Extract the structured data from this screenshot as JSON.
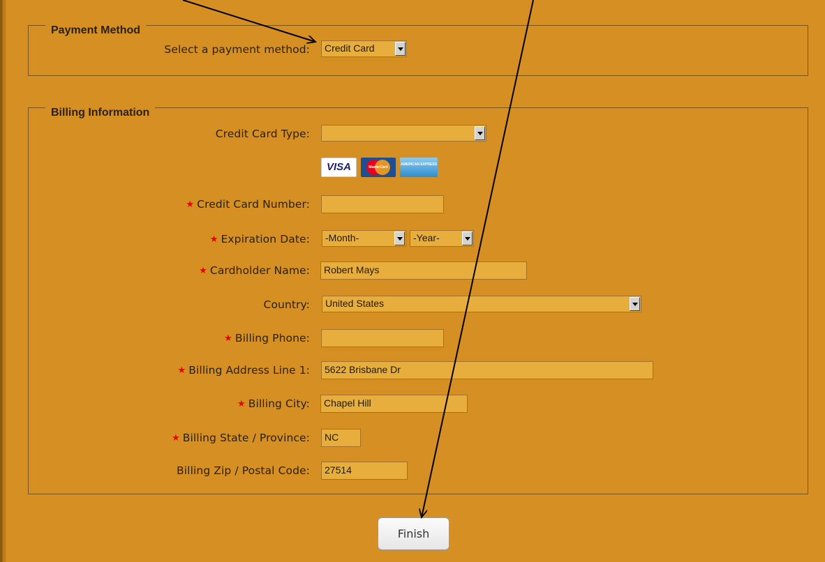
{
  "payment": {
    "legend": "Payment Method",
    "select_label": "Select a payment method:",
    "select_value": "Credit Card"
  },
  "billing": {
    "legend": "Billing Information",
    "card_type_label": "Credit Card Type:",
    "card_type_value": "",
    "card_logos": [
      "VISA",
      "MasterCard",
      "AMERICAN EXPRESS"
    ],
    "card_number_label": "Credit Card Number:",
    "card_number_value": "",
    "expiration_label": "Expiration Date:",
    "expiration_month": "-Month-",
    "expiration_year": "-Year-",
    "cardholder_label": "Cardholder Name:",
    "cardholder_value": "Robert Mays",
    "country_label": "Country:",
    "country_value": "United States",
    "phone_label": "Billing Phone:",
    "phone_value": "",
    "address_label": "Billing Address Line 1:",
    "address_value": "5622 Brisbane Dr",
    "city_label": "Billing City:",
    "city_value": "Chapel Hill",
    "state_label": "Billing State / Province:",
    "state_value": "NC",
    "zip_label": "Billing Zip / Postal Code:",
    "zip_value": "27514",
    "required_marker": "★"
  },
  "finish_label": "Finish",
  "colors": {
    "page_background": "#D68F22",
    "field_background": "#E7AE3D",
    "required_star": "#E60000",
    "annotation_arrow": "#000000"
  }
}
